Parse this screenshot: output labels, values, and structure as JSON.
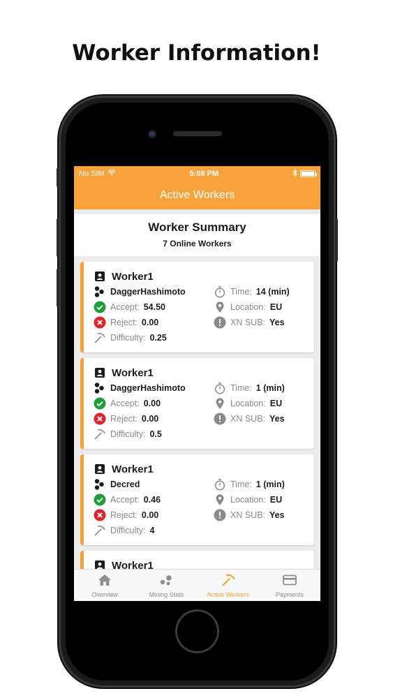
{
  "headline": "Worker Information!",
  "status_bar": {
    "carrier": "No SIM",
    "time": "5:08 PM"
  },
  "nav": {
    "title": "Active Workers"
  },
  "summary": {
    "title": "Worker Summary",
    "online": "7 Online Workers"
  },
  "labels": {
    "time": "Time:",
    "location": "Location:",
    "xn_sub": "XN SUB:",
    "accept": "Accept:",
    "reject": "Reject:",
    "difficulty": "Difficulty:"
  },
  "workers": [
    {
      "name": "Worker1",
      "algorithm": "DaggerHashimoto",
      "accept": "54.50",
      "reject": "0.00",
      "difficulty": "0.25",
      "time": "14 (min)",
      "location": "EU",
      "xn_sub": "Yes"
    },
    {
      "name": "Worker1",
      "algorithm": "DaggerHashimoto",
      "accept": "0.00",
      "reject": "0.00",
      "difficulty": "0.5",
      "time": "1 (min)",
      "location": "EU",
      "xn_sub": "Yes"
    },
    {
      "name": "Worker1",
      "algorithm": "Decred",
      "accept": "0.46",
      "reject": "0.00",
      "difficulty": "4",
      "time": "1 (min)",
      "location": "EU",
      "xn_sub": "Yes"
    },
    {
      "name": "Worker1"
    }
  ],
  "tabs": [
    {
      "label": "Overview",
      "icon": "home-icon"
    },
    {
      "label": "Mining Stats",
      "icon": "mining-stats-icon"
    },
    {
      "label": "Active Workers",
      "icon": "pickaxe-icon",
      "active": true
    },
    {
      "label": "Payments",
      "icon": "credit-card-icon"
    }
  ],
  "colors": {
    "accent": "#f7a23b",
    "accept": "#1f9d3a",
    "reject": "#e0242c"
  }
}
